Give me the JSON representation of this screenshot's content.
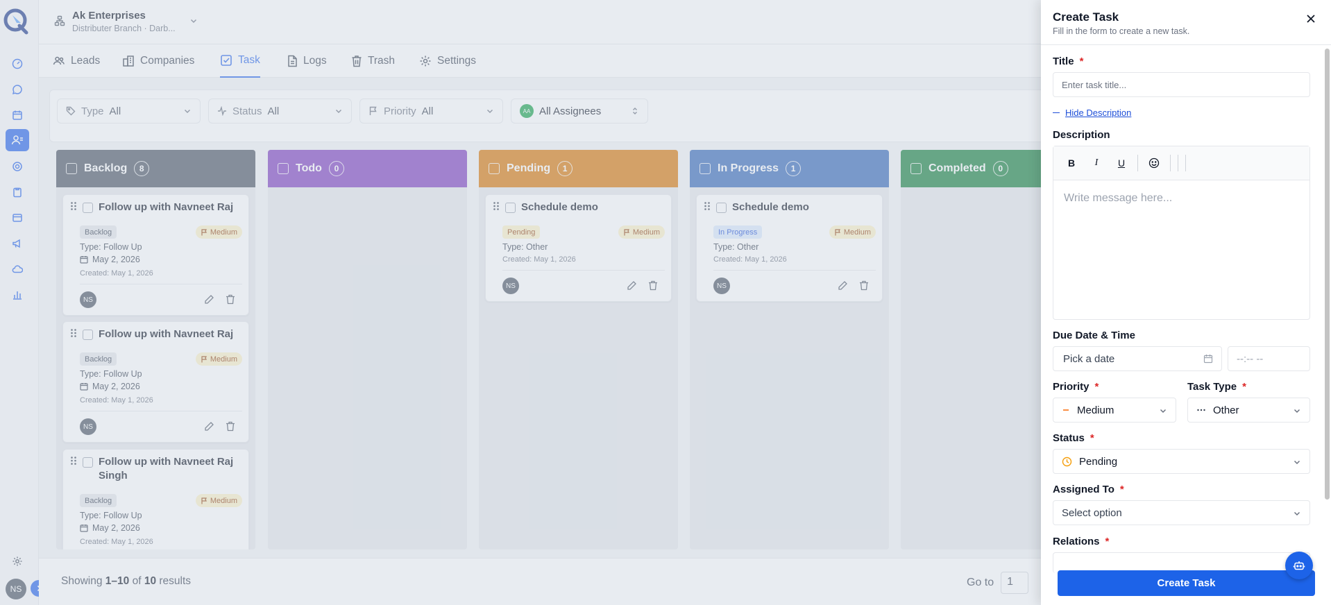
{
  "org": {
    "name": "Ak Enterprises",
    "sub": "Distributer Branch · Darb..."
  },
  "tabs": [
    {
      "label": "Leads",
      "icon": "users-icon"
    },
    {
      "label": "Companies",
      "icon": "buildings-icon"
    },
    {
      "label": "Task",
      "icon": "check-square-icon"
    },
    {
      "label": "Logs",
      "icon": "document-icon"
    },
    {
      "label": "Trash",
      "icon": "trash-icon"
    },
    {
      "label": "Settings",
      "icon": "gear-icon"
    }
  ],
  "filters": {
    "type": {
      "label": "Type",
      "value": "All"
    },
    "status": {
      "label": "Status",
      "value": "All"
    },
    "priority": {
      "label": "Priority",
      "value": "All"
    },
    "assignees": {
      "initials": "AA",
      "value": "All Assignees"
    }
  },
  "columns": [
    {
      "name": "Backlog",
      "count": "8",
      "color": "#4b5563"
    },
    {
      "name": "Todo",
      "count": "0",
      "color": "#7e3fbf"
    },
    {
      "name": "Pending",
      "count": "1",
      "color": "#d97706"
    },
    {
      "name": "In Progress",
      "count": "1",
      "color": "#3568b8"
    },
    {
      "name": "Completed",
      "count": "0",
      "color": "#15803d"
    }
  ],
  "cards": {
    "backlog": [
      {
        "title": "Follow up with Navneet Raj",
        "status": "Backlog",
        "priority": "Medium",
        "type": "Type: Follow Up",
        "due": "May 2, 2026",
        "created": "Created: May 1, 2026",
        "assignee": "NS"
      },
      {
        "title": "Follow up with Navneet Raj",
        "status": "Backlog",
        "priority": "Medium",
        "type": "Type: Follow Up",
        "due": "May 2, 2026",
        "created": "Created: May 1, 2026",
        "assignee": "NS"
      },
      {
        "title": "Follow up with Navneet Raj Singh",
        "status": "Backlog",
        "priority": "Medium",
        "type": "Type: Follow Up",
        "due": "May 2, 2026",
        "created": "Created: May 1, 2026"
      }
    ],
    "pending": [
      {
        "title": "Schedule demo",
        "status": "Pending",
        "priority": "Medium",
        "type": "Type: Other",
        "created": "Created: May 1, 2026",
        "assignee": "NS"
      }
    ],
    "in_progress": [
      {
        "title": "Schedule demo",
        "status": "In Progress",
        "priority": "Medium",
        "type": "Type: Other",
        "created": "Created: May 1, 2026",
        "assignee": "NS"
      }
    ]
  },
  "footer": {
    "showing": "Showing",
    "range": "1–10",
    "of": "of",
    "total": "10",
    "results": "results",
    "goto_label": "Go to",
    "goto_value": "1"
  },
  "user": {
    "initials": "NS"
  },
  "drawer": {
    "title": "Create Task",
    "subtitle": "Fill in the form to create a new task.",
    "title_label": "Title",
    "title_placeholder": "Enter task title...",
    "hide_description": "Hide Description",
    "description_label": "Description",
    "toolbar": {
      "bold": "B",
      "italic": "I",
      "underline": "U"
    },
    "editor_placeholder": "Write message here...",
    "due_label": "Due Date & Time",
    "date_placeholder": "Pick a date",
    "time_placeholder": "--:-- --",
    "priority_label": "Priority",
    "priority_value": "Medium",
    "task_type_label": "Task Type",
    "task_type_value": "Other",
    "status_label": "Status",
    "status_value": "Pending",
    "assigned_label": "Assigned To",
    "assigned_placeholder": "Select option",
    "relations_label": "Relations",
    "required_mark": "*",
    "submit": "Create Task"
  },
  "colors": {
    "accent": "#1d63e8",
    "priority_badge_bg": "#fef3c7",
    "required": "#dc2626"
  }
}
